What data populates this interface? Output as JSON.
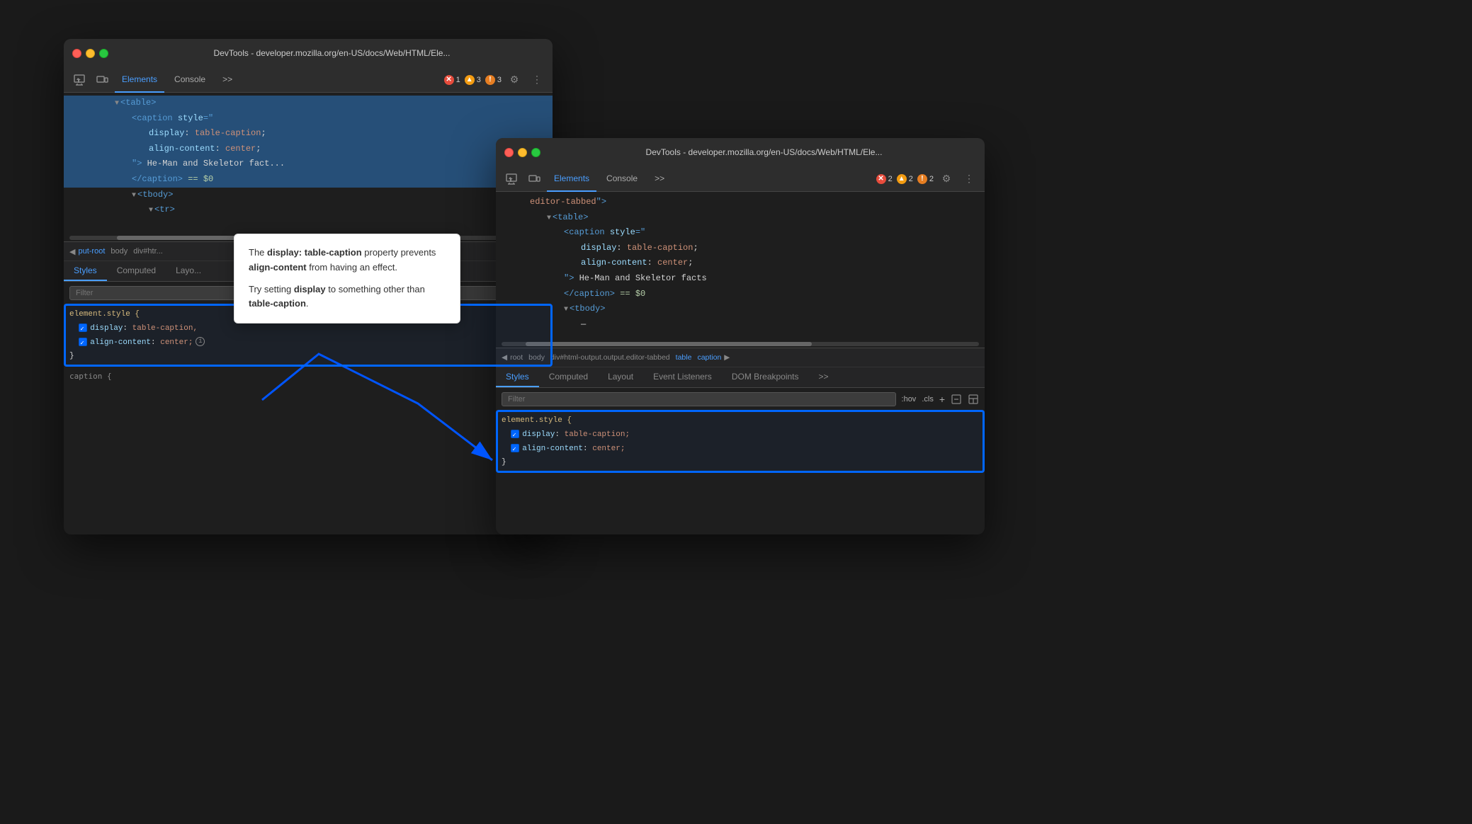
{
  "windows": {
    "back": {
      "title": "DevTools - developer.mozilla.org/en-US/docs/Web/HTML/Ele...",
      "tabs": [
        "Elements",
        "Console",
        ">>"
      ],
      "active_tab": "Elements",
      "badges": [
        {
          "type": "error",
          "count": "1"
        },
        {
          "type": "warning",
          "count": "3"
        },
        {
          "type": "info",
          "count": "3"
        }
      ],
      "html_lines": [
        {
          "text": "▼<table>",
          "indent": 3,
          "selected": true
        },
        {
          "text": "<caption style=\"",
          "indent": 4,
          "selected": true
        },
        {
          "text": "display: table-caption;",
          "indent": 5,
          "selected": true
        },
        {
          "text": "align-content: center;",
          "indent": 5,
          "selected": true
        },
        {
          "text": "\"> He-Man and Skeletor fact...",
          "indent": 4,
          "selected": true
        },
        {
          "text": "</caption> == $0",
          "indent": 4,
          "selected": true
        },
        {
          "text": "▼<tbody>",
          "indent": 4,
          "selected": false
        },
        {
          "text": "▼<tr>",
          "indent": 5,
          "selected": false
        }
      ],
      "breadcrumbs": [
        "◀",
        "put-root",
        "body",
        "div#htr..."
      ],
      "styles": {
        "tabs": [
          "Styles",
          "Computed",
          "Layo..."
        ],
        "active_tab": "Styles",
        "filter_placeholder": "Filter",
        "rule": {
          "selector": "element.style {",
          "properties": [
            {
              "name": "display",
              "value": "table-caption,"
            },
            {
              "name": "align-content",
              "value": "center;",
              "has_info": true
            }
          ],
          "close": "}"
        }
      }
    },
    "front": {
      "title": "DevTools - developer.mozilla.org/en-US/docs/Web/HTML/Ele...",
      "tabs": [
        "Elements",
        "Console",
        ">>"
      ],
      "active_tab": "Elements",
      "badges": [
        {
          "type": "error",
          "count": "2"
        },
        {
          "type": "warning",
          "count": "2"
        },
        {
          "type": "info",
          "count": "2"
        }
      ],
      "html_lines": [
        {
          "text": "editor-tabbed\">",
          "indent": 2
        },
        {
          "text": "▼<table>",
          "indent": 3
        },
        {
          "text": "<caption style=\"",
          "indent": 4
        },
        {
          "text": "display: table-caption;",
          "indent": 5
        },
        {
          "text": "align-content: center;",
          "indent": 5
        },
        {
          "text": "\"> He-Man and Skeletor facts",
          "indent": 4
        },
        {
          "text": "</caption> == $0",
          "indent": 4
        },
        {
          "text": "▼<tbody>",
          "indent": 4
        },
        {
          "text": "—",
          "indent": 5
        }
      ],
      "breadcrumbs": [
        "◀",
        "root",
        "body",
        "div#html-output.output.editor-tabbed",
        "table",
        "caption",
        "▶"
      ],
      "styles": {
        "tabs": [
          "Styles",
          "Computed",
          "Layout",
          "Event Listeners",
          "DOM Breakpoints",
          ">>"
        ],
        "active_tab": "Styles",
        "filter_placeholder": "Filter",
        "toolbar_items": [
          ":hov",
          ".cls",
          "+"
        ],
        "rule": {
          "selector": "element.style {",
          "properties": [
            {
              "name": "display",
              "value": "table-caption;"
            },
            {
              "name": "align-content",
              "value": "center;"
            }
          ],
          "close": "}"
        }
      }
    }
  },
  "tooltip": {
    "text1_before": "The ",
    "text1_bold": "display: table-caption",
    "text1_after": " property prevents ",
    "text2_bold": "align-content",
    "text2_after": " from having an effect.",
    "text3_before": "Try setting ",
    "text3_bold": "display",
    "text3_after": " to something other than ",
    "text4_bold": "table-caption",
    "text4_after": "."
  },
  "icons": {
    "inspector": "⬚",
    "device": "⊡",
    "more": "»",
    "gear": "⚙",
    "dots": "⋮",
    "back_arrow": "◀",
    "forward_arrow": "▶"
  }
}
